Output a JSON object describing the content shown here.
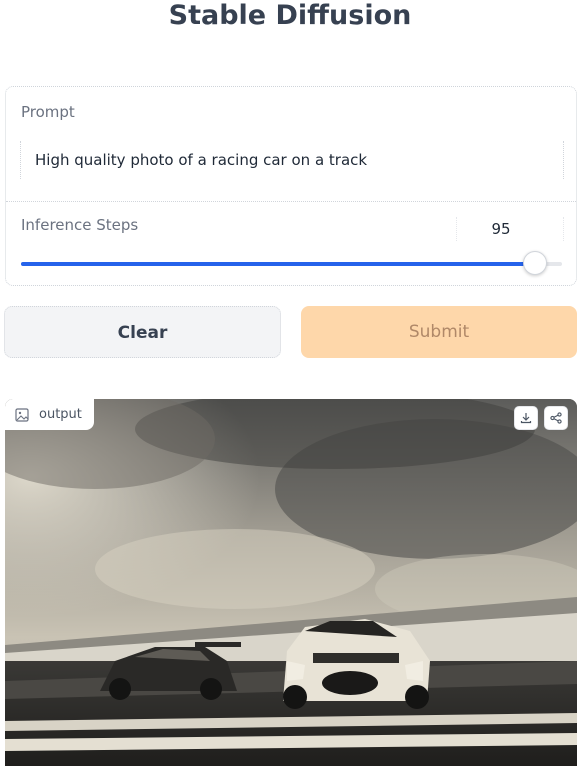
{
  "app": {
    "title": "Stable Diffusion"
  },
  "prompt": {
    "label": "Prompt",
    "value": "High quality photo of a racing car on a track"
  },
  "steps": {
    "label": "Inference Steps",
    "value": "95",
    "fraction": 0.95
  },
  "buttons": {
    "clear_label": "Clear",
    "submit_label": "Submit"
  },
  "output": {
    "label": "output",
    "label_icon": "image-icon",
    "download_icon": "download-icon",
    "share_icon": "share-icon"
  },
  "colors": {
    "accent": "#2563eb",
    "submit_bg": "#fed7aa",
    "submit_text": "#b08868"
  }
}
